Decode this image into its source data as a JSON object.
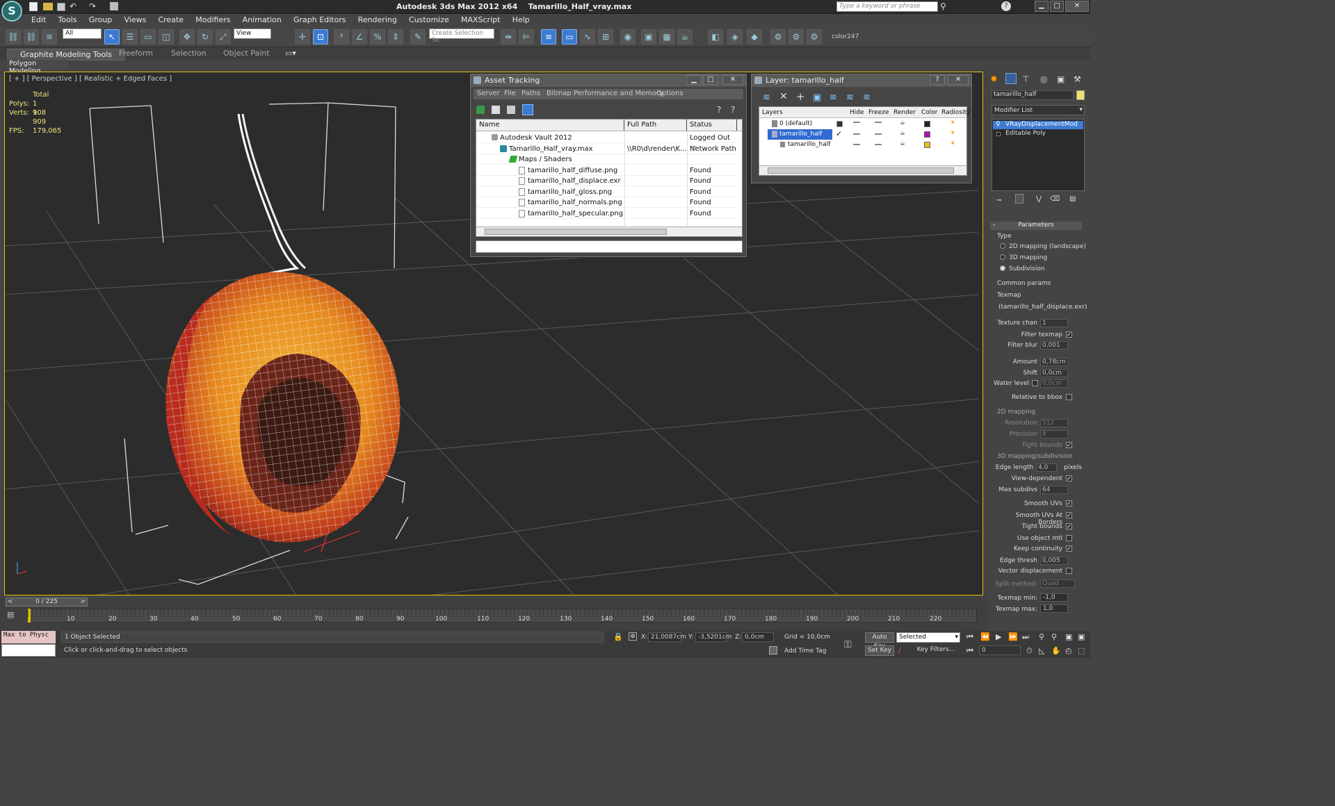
{
  "title": {
    "app": "Autodesk 3ds Max  2012 x64",
    "file": "Tamarillo_Half_vray.max",
    "search_placeholder": "Type a keyword or phrase"
  },
  "menu": [
    "Edit",
    "Tools",
    "Group",
    "Views",
    "Create",
    "Modifiers",
    "Animation",
    "Graph Editors",
    "Rendering",
    "Customize",
    "MAXScript",
    "Help"
  ],
  "toolbar": {
    "filter": "All",
    "ref_coord": "View",
    "selection_set": "Create Selection Se",
    "color_label": "color247"
  },
  "ribbon": {
    "tabs": [
      "Graphite Modeling Tools",
      "Freeform",
      "Selection",
      "Object Paint"
    ],
    "sub": "Polygon Modeling"
  },
  "viewport": {
    "label": "[ + ] [ Perspective ] [ Realistic + Edged Faces ]",
    "stats": {
      "total": "Total",
      "polys_label": "Polys:",
      "polys": "1 908",
      "verts_label": "Verts:",
      "verts": "1 909",
      "fps_label": "FPS:",
      "fps": "179,065"
    }
  },
  "asset_tracking": {
    "title": "Asset Tracking",
    "menu": [
      "Server",
      "File",
      "Paths",
      "Bitmap Performance and Memory",
      "Options"
    ],
    "columns": [
      "Name",
      "Full Path",
      "Status"
    ],
    "rows": [
      {
        "name": "Autodesk Vault 2012",
        "path": "",
        "status": "Logged Out ..."
      },
      {
        "name": "Tamarillo_Half_vray.max",
        "path": "\\\\R0\\d\\render\\K...",
        "status": "Network Path"
      },
      {
        "name": "Maps / Shaders",
        "path": "",
        "status": ""
      },
      {
        "name": "tamarillo_half_diffuse.png",
        "path": "",
        "status": "Found"
      },
      {
        "name": "tamarillo_half_displace.exr",
        "path": "",
        "status": "Found"
      },
      {
        "name": "tamarillo_half_gloss.png",
        "path": "",
        "status": "Found"
      },
      {
        "name": "tamarillo_half_normals.png",
        "path": "",
        "status": "Found"
      },
      {
        "name": "tamarillo_half_specular.png",
        "path": "",
        "status": "Found"
      }
    ]
  },
  "layers": {
    "title": "Layer: tamarillo_half",
    "columns": [
      "Layers",
      "Hide",
      "Freeze",
      "Render",
      "Color",
      "Radiosity"
    ],
    "rows": [
      {
        "name": "0 (default)",
        "color": "#222222"
      },
      {
        "name": "tamarillo_half",
        "color": "#b010b0"
      },
      {
        "name": "tamarillo_half",
        "color": "#e0c020"
      }
    ]
  },
  "command_panel": {
    "object_name": "tamarillo_half",
    "modifier_list": "Modifier List",
    "stack": [
      "VRayDisplacementMod",
      "Editable Poly"
    ],
    "rollout": "Parameters",
    "type_label": "Type",
    "type_options": [
      "2D mapping (landscape)",
      "3D mapping",
      "Subdivision"
    ],
    "common_params": "Common params",
    "texmap_label": "Texmap",
    "texmap": "(tamarillo_half_displace.exr)",
    "texture_chan_label": "Texture chan",
    "texture_chan": "1",
    "filter_texmap": "Filter texmap",
    "filter_blur_label": "Filter blur",
    "filter_blur": "0,001",
    "amount_label": "Amount",
    "amount": "0,78cm",
    "shift_label": "Shift",
    "shift": "0,0cm",
    "water_level_label": "Water level",
    "water_level": "0,0cm",
    "relative_bbox": "Relative to bbox",
    "mapping2d": "2D mapping",
    "resolution_label": "Resolution",
    "resolution": "512",
    "precision_label": "Precision",
    "precision": "8",
    "tight_bounds": "Tight bounds",
    "mapping3d": "3D mapping/subdivision",
    "edge_length_label": "Edge length",
    "edge_length": "4,0",
    "pixels": "pixels",
    "view_dependent": "View-dependent",
    "max_subdivs_label": "Max subdivs",
    "max_subdivs": "64",
    "smooth_uvs": "Smooth UVs",
    "smooth_uvs_borders": "Smooth UVs At Borders",
    "tight_bounds2": "Tight bounds",
    "use_object_mtl": "Use object mtl",
    "keep_continuity": "Keep continuity",
    "edge_thresh_label": "Edge thresh",
    "edge_thresh": "0,005",
    "vector_disp": "Vector displacement",
    "split_method_label": "Split method:",
    "split_method": "Quad",
    "texmap_min_label": "Texmap min:",
    "texmap_min": "-1,0",
    "texmap_max_label": "Texmap max:",
    "texmap_max": "1,0"
  },
  "timeline": {
    "frame": "0 / 225",
    "ticks": [
      "10",
      "20",
      "30",
      "40",
      "50",
      "60",
      "70",
      "80",
      "90",
      "100",
      "110",
      "120",
      "130",
      "140",
      "150",
      "160",
      "170",
      "180",
      "190",
      "200",
      "210",
      "220"
    ]
  },
  "status": {
    "script_box": "Max to Physc",
    "selected": "1 Object Selected",
    "prompt": "Click or click-and-drag to select objects",
    "x_label": "X:",
    "x": "21,0087cm",
    "y_label": "Y:",
    "y": "-3,5201cm",
    "z_label": "Z:",
    "z": "0,0cm",
    "grid": "Grid = 10,0cm",
    "add_time_tag": "Add Time Tag",
    "auto_key": "Auto Key",
    "auto_key_mode": "Selected",
    "set_key": "Set Key",
    "key_filters": "Key Filters...",
    "frame_field": "0"
  }
}
